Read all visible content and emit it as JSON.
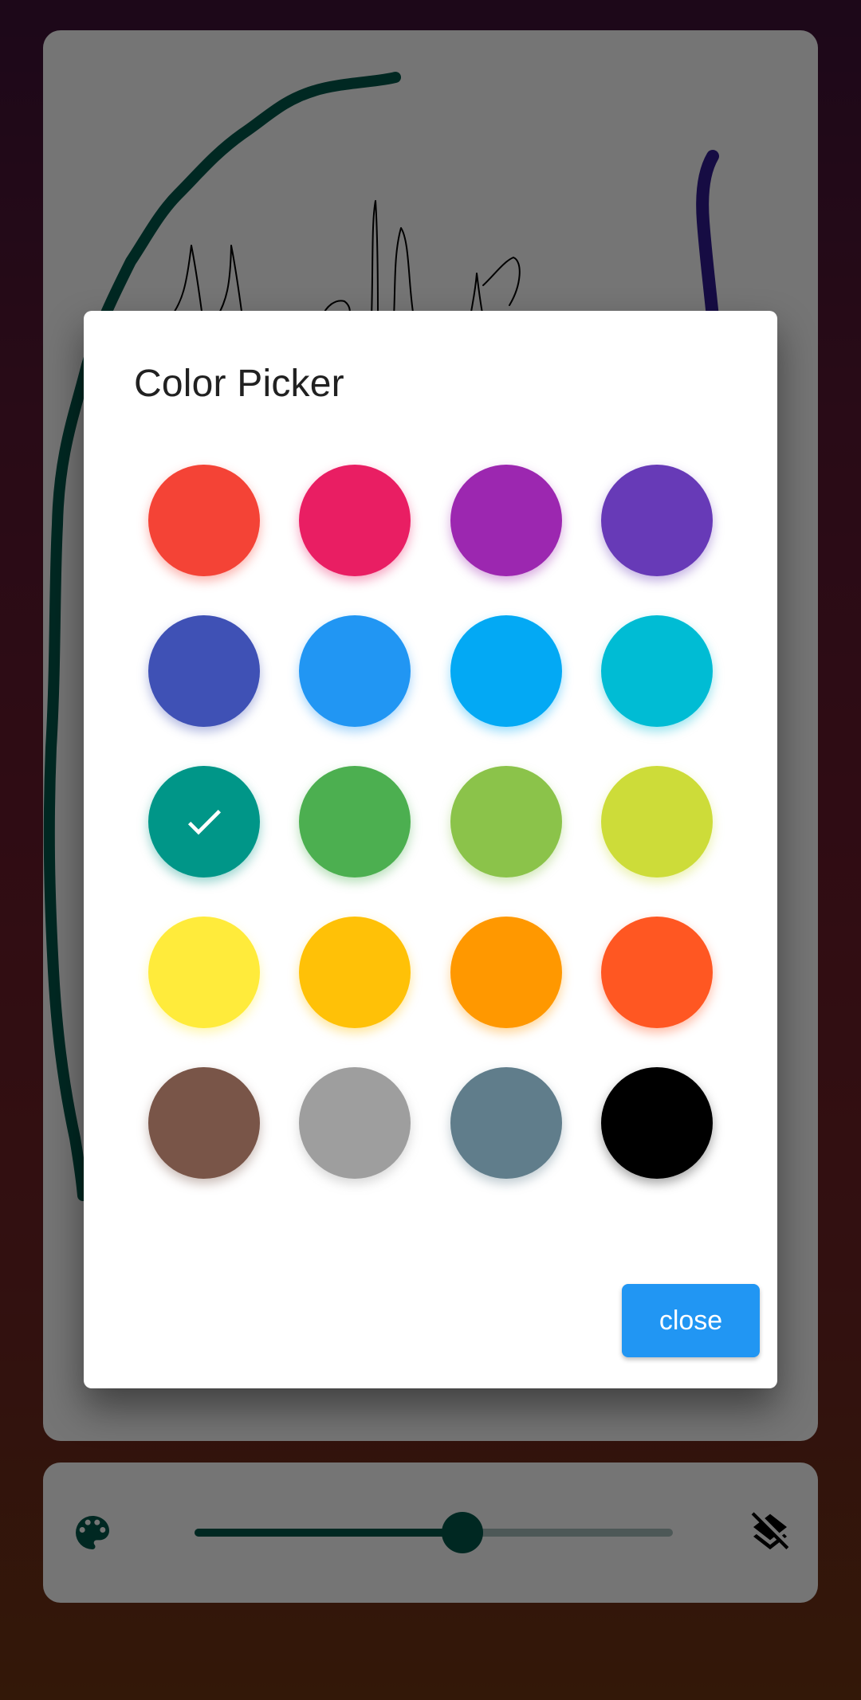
{
  "dialog": {
    "title": "Color Picker",
    "close_label": "close",
    "selected_index": 8,
    "swatches": [
      {
        "name": "red",
        "color": "#f44336"
      },
      {
        "name": "pink",
        "color": "#e91e63"
      },
      {
        "name": "purple",
        "color": "#9c27b0"
      },
      {
        "name": "deep-purple",
        "color": "#673ab7"
      },
      {
        "name": "indigo",
        "color": "#3f51b5"
      },
      {
        "name": "blue",
        "color": "#2196f3"
      },
      {
        "name": "light-blue",
        "color": "#03a9f4"
      },
      {
        "name": "cyan",
        "color": "#00bcd4"
      },
      {
        "name": "teal",
        "color": "#009688"
      },
      {
        "name": "green",
        "color": "#4caf50"
      },
      {
        "name": "light-green",
        "color": "#8bc34a"
      },
      {
        "name": "lime",
        "color": "#cddc39"
      },
      {
        "name": "yellow",
        "color": "#ffeb3b"
      },
      {
        "name": "amber",
        "color": "#ffc107"
      },
      {
        "name": "orange",
        "color": "#ff9800"
      },
      {
        "name": "deep-orange",
        "color": "#ff5722"
      },
      {
        "name": "brown",
        "color": "#795548"
      },
      {
        "name": "grey",
        "color": "#9e9e9e"
      },
      {
        "name": "blue-grey",
        "color": "#607d8b"
      },
      {
        "name": "black",
        "color": "#000000"
      }
    ]
  },
  "toolbar": {
    "palette_icon": "palette-icon",
    "layers_icon": "layers-clear-icon",
    "stroke_slider_value": 0.56,
    "accent_color": "#00574b"
  },
  "canvas": {
    "stroke_colors": [
      "#00574b",
      "#311b92",
      "#000000"
    ]
  }
}
